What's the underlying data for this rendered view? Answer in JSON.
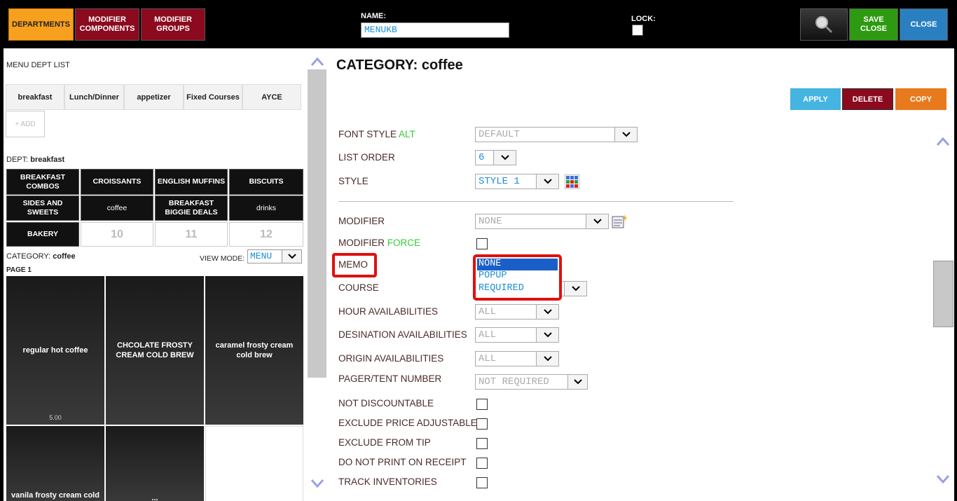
{
  "top": {
    "departments": "DEPARTMENTS",
    "modifier_components": "MODIFIER COMPONENTS",
    "modifier_groups": "MODIFIER GROUPS",
    "name_label": "NAME:",
    "name_value": "MENUKB",
    "lock_label": "LOCK:",
    "save_close": "SAVE CLOSE",
    "close": "CLOSE"
  },
  "left": {
    "menu_dept_list": "MENU DEPT LIST",
    "tabs": [
      "breakfast",
      "Lunch/Dinner",
      "appetizer",
      "Fixed Courses",
      "AYCE"
    ],
    "add": "+ ADD",
    "dept_prefix": "DEPT:",
    "dept_name": "breakfast",
    "categories": [
      "BREAKFAST COMBOS",
      "CROISSANTS",
      "ENGLISH MUFFINS",
      "BISCUITS",
      "SIDES AND SWEETS",
      "coffee",
      "BREAKFAST BIGGIE DEALS",
      "drinks",
      "BAKERY"
    ],
    "empty_slots": [
      "10",
      "11",
      "12"
    ],
    "category_prefix": "CATEGORY:",
    "category_name": "coffee",
    "view_mode_label": "VIEW MODE:",
    "view_mode_value": "MENU",
    "page_label": "PAGE 1",
    "items": [
      {
        "name": "regular hot coffee",
        "price": "5.00"
      },
      {
        "name": "CHCOLATE FROSTY CREAM COLD BREW",
        "price": ""
      },
      {
        "name": "caramel frosty cream cold brew",
        "price": ""
      },
      {
        "name": "vanila frosty cream cold",
        "price": ""
      },
      {
        "name": "...",
        "price": ""
      }
    ]
  },
  "right": {
    "title": "CATEGORY: coffee",
    "apply": "APPLY",
    "delete": "DELETE",
    "copy": "COPY",
    "font_style": "FONT STYLE",
    "alt": "ALT",
    "font_style_value": "DEFAULT",
    "list_order": "LIST ORDER",
    "list_order_value": "6",
    "style": "STYLE",
    "style_value": "STYLE 1",
    "modifier": "MODIFIER",
    "modifier_value": "NONE",
    "modifier_force": "MODIFIER",
    "force": "FORCE",
    "memo": "MEMO",
    "memo_options": [
      "NONE",
      "POPUP",
      "REQUIRED"
    ],
    "course": "COURSE",
    "hour": "HOUR AVAILABILITIES",
    "hour_value": "ALL",
    "dest": "DESINATION AVAILABILITIES",
    "dest_value": "ALL",
    "origin": "ORIGIN AVAILABILITIES",
    "origin_value": "ALL",
    "pager": "PAGER/TENT NUMBER",
    "pager_value": "NOT REQUIRED",
    "not_disc": "NOT DISCOUNTABLE",
    "excl_price": "EXCLUDE PRICE ADJUSTABLE",
    "excl_tip": "EXCLUDE FROM TIP",
    "no_print": "DO NOT PRINT ON RECEIPT",
    "track": "TRACK INVENTORIES"
  },
  "colors": {
    "orange": "#f7a01e",
    "maroon": "#8b0a1e",
    "green": "#2e9a12",
    "blue": "#2a7fc0",
    "highlight": "#e01010"
  }
}
